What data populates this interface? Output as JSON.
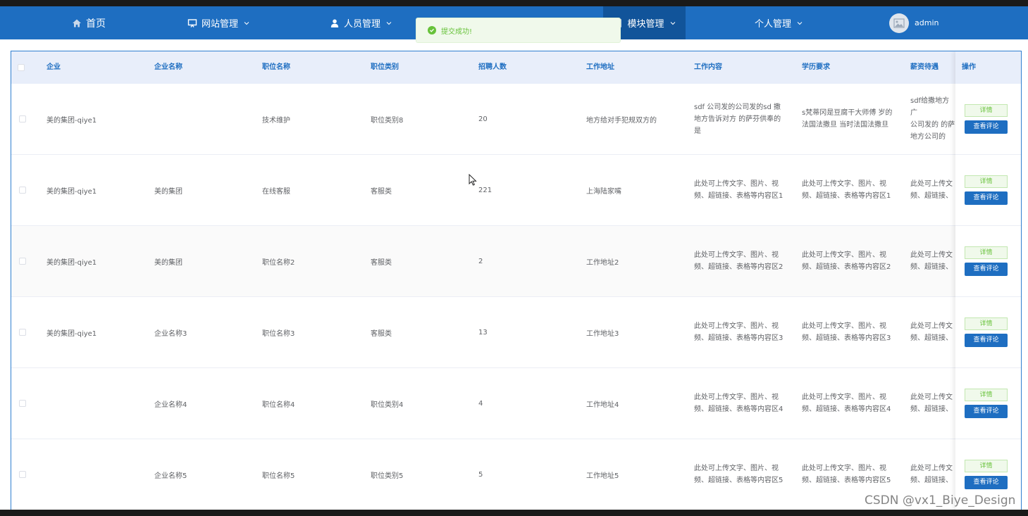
{
  "nav": {
    "home": "首页",
    "site": "网站管理",
    "staff": "人员管理",
    "block": "模块管理",
    "personal": "个人管理",
    "username": "admin"
  },
  "toast": {
    "message": "提交成功!"
  },
  "table": {
    "headers": [
      "企业",
      "企业名称",
      "职位名称",
      "职位类别",
      "招聘人数",
      "工作地址",
      "工作内容",
      "学历要求",
      "薪资待遇",
      "操作"
    ],
    "rows": [
      {
        "company": "美的集团-qiye1",
        "company_name": "",
        "position": "技术维护",
        "category": "职位类别8",
        "count": "20",
        "address": "地方给对手犯规双方的",
        "content": [
          "sdf 公司发的公司发的sd 撒",
          "地方告诉对方 的萨芬供奉的",
          "是"
        ],
        "education": [
          "s梵蒂冈是豆腐干大师傅 岁的",
          "法国法撒旦 当时法国法撒旦"
        ],
        "salary": [
          "sdf给撒地方广",
          "公司发的 的萨",
          "地方公司的"
        ]
      },
      {
        "company": "美的集团-qiye1",
        "company_name": "美的集团",
        "position": "在线客服",
        "category": "客服类",
        "count": "221",
        "address": "上海陆家嘴",
        "content": [
          "此处可上传文字、图片、视",
          "频、超链接、表格等内容区1"
        ],
        "education": [
          "此处可上传文字、图片、视",
          "频、超链接、表格等内容区1"
        ],
        "salary": [
          "此处可上传文",
          "频、超链接、"
        ]
      },
      {
        "company": "美的集团-qiye1",
        "company_name": "美的集团",
        "position": "职位名称2",
        "category": "客服类",
        "count": "2",
        "address": "工作地址2",
        "content": [
          "此处可上传文字、图片、视",
          "频、超链接、表格等内容区2"
        ],
        "education": [
          "此处可上传文字、图片、视",
          "频、超链接、表格等内容区2"
        ],
        "salary": [
          "此处可上传文",
          "频、超链接、"
        ]
      },
      {
        "company": "美的集团-qiye1",
        "company_name": "企业名称3",
        "position": "职位名称3",
        "category": "客服类",
        "count": "13",
        "address": "工作地址3",
        "content": [
          "此处可上传文字、图片、视",
          "频、超链接、表格等内容区3"
        ],
        "education": [
          "此处可上传文字、图片、视",
          "频、超链接、表格等内容区3"
        ],
        "salary": [
          "此处可上传文",
          "频、超链接、"
        ]
      },
      {
        "company": "",
        "company_name": "企业名称4",
        "position": "职位名称4",
        "category": "职位类别4",
        "count": "4",
        "address": "工作地址4",
        "content": [
          "此处可上传文字、图片、视",
          "频、超链接、表格等内容区4"
        ],
        "education": [
          "此处可上传文字、图片、视",
          "频、超链接、表格等内容区4"
        ],
        "salary": [
          "此处可上传文",
          "频、超链接、"
        ]
      },
      {
        "company": "",
        "company_name": "企业名称5",
        "position": "职位名称5",
        "category": "职位类别5",
        "count": "5",
        "address": "工作地址5",
        "content": [
          "此处可上传文字、图片、视",
          "频、超链接、表格等内容区5"
        ],
        "education": [
          "此处可上传文字、图片、视",
          "频、超链接、表格等内容区5"
        ],
        "salary": [
          "此处可上传文",
          "频、超链接、"
        ]
      }
    ],
    "detail_label": "详情",
    "review_label": "查看评论"
  },
  "watermark": "CSDN @vx1_Biye_Design",
  "colors": {
    "nav": "#1e6ec1",
    "nav_active": "#11549a",
    "success": "#67c23a",
    "header_bg": "#e8eefa"
  },
  "icons": [
    "home-icon",
    "monitor-icon",
    "user-icon",
    "block-icon",
    "chevron-down-icon",
    "image-icon",
    "check-circle-icon",
    "cursor-icon"
  ]
}
